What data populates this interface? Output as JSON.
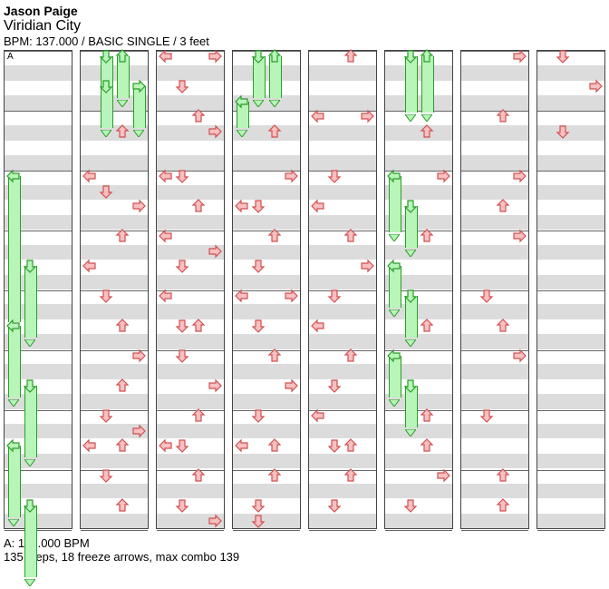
{
  "header": {
    "artist": "Jason Paige",
    "song": "Viridian City",
    "meta": "BPM: 137.000 / BASIC SINGLE / 3 feet"
  },
  "footer": {
    "bpm_label": "A: 137.000 BPM",
    "stats": "135 steps, 18 freeze arrows, max combo 139"
  },
  "layout": {
    "columns": 8,
    "beats_per_column": 32,
    "col_label_first": "A"
  },
  "chart_data": {
    "type": "stepchart",
    "lanes": [
      "left",
      "down",
      "up",
      "right"
    ],
    "columns": [
      {
        "index": 0,
        "notes": [
          {
            "beat": 8,
            "lane": "left",
            "type": "freeze",
            "len": 10
          },
          {
            "beat": 14,
            "lane": "down",
            "type": "freeze",
            "len": 5
          },
          {
            "beat": 18,
            "lane": "left",
            "type": "freeze",
            "len": 5
          },
          {
            "beat": 22,
            "lane": "down",
            "type": "freeze",
            "len": 5
          },
          {
            "beat": 26,
            "lane": "left",
            "type": "freeze",
            "len": 5
          },
          {
            "beat": 30,
            "lane": "down",
            "type": "freeze",
            "len": 5
          }
        ]
      },
      {
        "index": 1,
        "notes": [
          {
            "beat": 0,
            "lane": "down",
            "type": "freeze",
            "len": 3
          },
          {
            "beat": 0,
            "lane": "up",
            "type": "freeze",
            "len": 3
          },
          {
            "beat": 2,
            "lane": "down",
            "type": "freeze",
            "len": 3
          },
          {
            "beat": 2,
            "lane": "right",
            "type": "freeze",
            "len": 3
          },
          {
            "beat": 5,
            "lane": "up",
            "type": "tap"
          },
          {
            "beat": 8,
            "lane": "left",
            "type": "tap"
          },
          {
            "beat": 9,
            "lane": "down",
            "type": "tap"
          },
          {
            "beat": 10,
            "lane": "right",
            "type": "tap"
          },
          {
            "beat": 12,
            "lane": "up",
            "type": "tap"
          },
          {
            "beat": 14,
            "lane": "left",
            "type": "tap"
          },
          {
            "beat": 16,
            "lane": "down",
            "type": "tap"
          },
          {
            "beat": 18,
            "lane": "up",
            "type": "tap"
          },
          {
            "beat": 20,
            "lane": "right",
            "type": "tap"
          },
          {
            "beat": 22,
            "lane": "up",
            "type": "tap"
          },
          {
            "beat": 24,
            "lane": "down",
            "type": "tap"
          },
          {
            "beat": 25,
            "lane": "right",
            "type": "tap"
          },
          {
            "beat": 26,
            "lane": "left",
            "type": "tap"
          },
          {
            "beat": 26,
            "lane": "up",
            "type": "tap"
          },
          {
            "beat": 28,
            "lane": "down",
            "type": "tap"
          },
          {
            "beat": 30,
            "lane": "up",
            "type": "tap"
          }
        ]
      },
      {
        "index": 2,
        "notes": [
          {
            "beat": 0,
            "lane": "left",
            "type": "tap"
          },
          {
            "beat": 0,
            "lane": "right",
            "type": "tap"
          },
          {
            "beat": 2,
            "lane": "down",
            "type": "tap"
          },
          {
            "beat": 4,
            "lane": "up",
            "type": "tap"
          },
          {
            "beat": 5,
            "lane": "right",
            "type": "tap"
          },
          {
            "beat": 8,
            "lane": "left",
            "type": "tap"
          },
          {
            "beat": 8,
            "lane": "down",
            "type": "tap"
          },
          {
            "beat": 10,
            "lane": "up",
            "type": "tap"
          },
          {
            "beat": 12,
            "lane": "left",
            "type": "tap"
          },
          {
            "beat": 13,
            "lane": "right",
            "type": "tap"
          },
          {
            "beat": 14,
            "lane": "down",
            "type": "tap"
          },
          {
            "beat": 16,
            "lane": "left",
            "type": "tap"
          },
          {
            "beat": 18,
            "lane": "down",
            "type": "tap"
          },
          {
            "beat": 18,
            "lane": "up",
            "type": "tap"
          },
          {
            "beat": 20,
            "lane": "down",
            "type": "tap"
          },
          {
            "beat": 22,
            "lane": "right",
            "type": "tap"
          },
          {
            "beat": 24,
            "lane": "up",
            "type": "tap"
          },
          {
            "beat": 26,
            "lane": "left",
            "type": "tap"
          },
          {
            "beat": 26,
            "lane": "down",
            "type": "tap"
          },
          {
            "beat": 28,
            "lane": "up",
            "type": "tap"
          },
          {
            "beat": 30,
            "lane": "down",
            "type": "tap"
          },
          {
            "beat": 31,
            "lane": "right",
            "type": "tap"
          }
        ]
      },
      {
        "index": 3,
        "notes": [
          {
            "beat": 0,
            "lane": "down",
            "type": "freeze",
            "len": 3
          },
          {
            "beat": 0,
            "lane": "up",
            "type": "freeze",
            "len": 3
          },
          {
            "beat": 3,
            "lane": "left",
            "type": "freeze",
            "len": 2
          },
          {
            "beat": 5,
            "lane": "up",
            "type": "tap"
          },
          {
            "beat": 8,
            "lane": "right",
            "type": "tap"
          },
          {
            "beat": 10,
            "lane": "left",
            "type": "tap"
          },
          {
            "beat": 10,
            "lane": "down",
            "type": "tap"
          },
          {
            "beat": 12,
            "lane": "up",
            "type": "tap"
          },
          {
            "beat": 14,
            "lane": "down",
            "type": "tap"
          },
          {
            "beat": 16,
            "lane": "left",
            "type": "tap"
          },
          {
            "beat": 16,
            "lane": "right",
            "type": "tap"
          },
          {
            "beat": 18,
            "lane": "down",
            "type": "tap"
          },
          {
            "beat": 20,
            "lane": "up",
            "type": "tap"
          },
          {
            "beat": 22,
            "lane": "right",
            "type": "tap"
          },
          {
            "beat": 24,
            "lane": "down",
            "type": "tap"
          },
          {
            "beat": 26,
            "lane": "left",
            "type": "tap"
          },
          {
            "beat": 26,
            "lane": "up",
            "type": "tap"
          },
          {
            "beat": 28,
            "lane": "up",
            "type": "tap"
          },
          {
            "beat": 30,
            "lane": "down",
            "type": "tap"
          },
          {
            "beat": 31,
            "lane": "down",
            "type": "tap"
          }
        ]
      },
      {
        "index": 4,
        "notes": [
          {
            "beat": 0,
            "lane": "up",
            "type": "tap"
          },
          {
            "beat": 4,
            "lane": "left",
            "type": "tap"
          },
          {
            "beat": 4,
            "lane": "right",
            "type": "tap"
          },
          {
            "beat": 8,
            "lane": "down",
            "type": "tap"
          },
          {
            "beat": 10,
            "lane": "left",
            "type": "tap"
          },
          {
            "beat": 12,
            "lane": "up",
            "type": "tap"
          },
          {
            "beat": 14,
            "lane": "right",
            "type": "tap"
          },
          {
            "beat": 16,
            "lane": "down",
            "type": "tap"
          },
          {
            "beat": 18,
            "lane": "left",
            "type": "tap"
          },
          {
            "beat": 20,
            "lane": "up",
            "type": "tap"
          },
          {
            "beat": 22,
            "lane": "down",
            "type": "tap"
          },
          {
            "beat": 24,
            "lane": "left",
            "type": "tap"
          },
          {
            "beat": 26,
            "lane": "down",
            "type": "tap"
          },
          {
            "beat": 26,
            "lane": "up",
            "type": "tap"
          },
          {
            "beat": 28,
            "lane": "up",
            "type": "tap"
          },
          {
            "beat": 30,
            "lane": "down",
            "type": "tap"
          }
        ]
      },
      {
        "index": 5,
        "notes": [
          {
            "beat": 0,
            "lane": "down",
            "type": "freeze",
            "len": 4
          },
          {
            "beat": 0,
            "lane": "up",
            "type": "freeze",
            "len": 4
          },
          {
            "beat": 5,
            "lane": "up",
            "type": "tap"
          },
          {
            "beat": 8,
            "lane": "left",
            "type": "freeze",
            "len": 4
          },
          {
            "beat": 8,
            "lane": "right",
            "type": "tap"
          },
          {
            "beat": 10,
            "lane": "down",
            "type": "freeze",
            "len": 3
          },
          {
            "beat": 12,
            "lane": "up",
            "type": "tap"
          },
          {
            "beat": 14,
            "lane": "left",
            "type": "freeze",
            "len": 3
          },
          {
            "beat": 16,
            "lane": "down",
            "type": "freeze",
            "len": 3
          },
          {
            "beat": 18,
            "lane": "up",
            "type": "tap"
          },
          {
            "beat": 20,
            "lane": "left",
            "type": "freeze",
            "len": 3
          },
          {
            "beat": 22,
            "lane": "down",
            "type": "freeze",
            "len": 3
          },
          {
            "beat": 24,
            "lane": "up",
            "type": "tap"
          },
          {
            "beat": 26,
            "lane": "up",
            "type": "tap"
          },
          {
            "beat": 28,
            "lane": "right",
            "type": "tap"
          },
          {
            "beat": 30,
            "lane": "down",
            "type": "tap"
          }
        ]
      },
      {
        "index": 6,
        "notes": [
          {
            "beat": 0,
            "lane": "right",
            "type": "tap"
          },
          {
            "beat": 4,
            "lane": "up",
            "type": "tap"
          },
          {
            "beat": 8,
            "lane": "right",
            "type": "tap"
          },
          {
            "beat": 10,
            "lane": "up",
            "type": "tap"
          },
          {
            "beat": 12,
            "lane": "right",
            "type": "tap"
          },
          {
            "beat": 16,
            "lane": "down",
            "type": "tap"
          },
          {
            "beat": 18,
            "lane": "up",
            "type": "tap"
          },
          {
            "beat": 20,
            "lane": "right",
            "type": "tap"
          },
          {
            "beat": 24,
            "lane": "down",
            "type": "tap"
          },
          {
            "beat": 28,
            "lane": "up",
            "type": "tap"
          },
          {
            "beat": 30,
            "lane": "up",
            "type": "tap"
          }
        ]
      },
      {
        "index": 7,
        "notes": [
          {
            "beat": 0,
            "lane": "down",
            "type": "tap"
          },
          {
            "beat": 2,
            "lane": "right",
            "type": "tap"
          },
          {
            "beat": 5,
            "lane": "down",
            "type": "tap"
          }
        ]
      }
    ]
  }
}
